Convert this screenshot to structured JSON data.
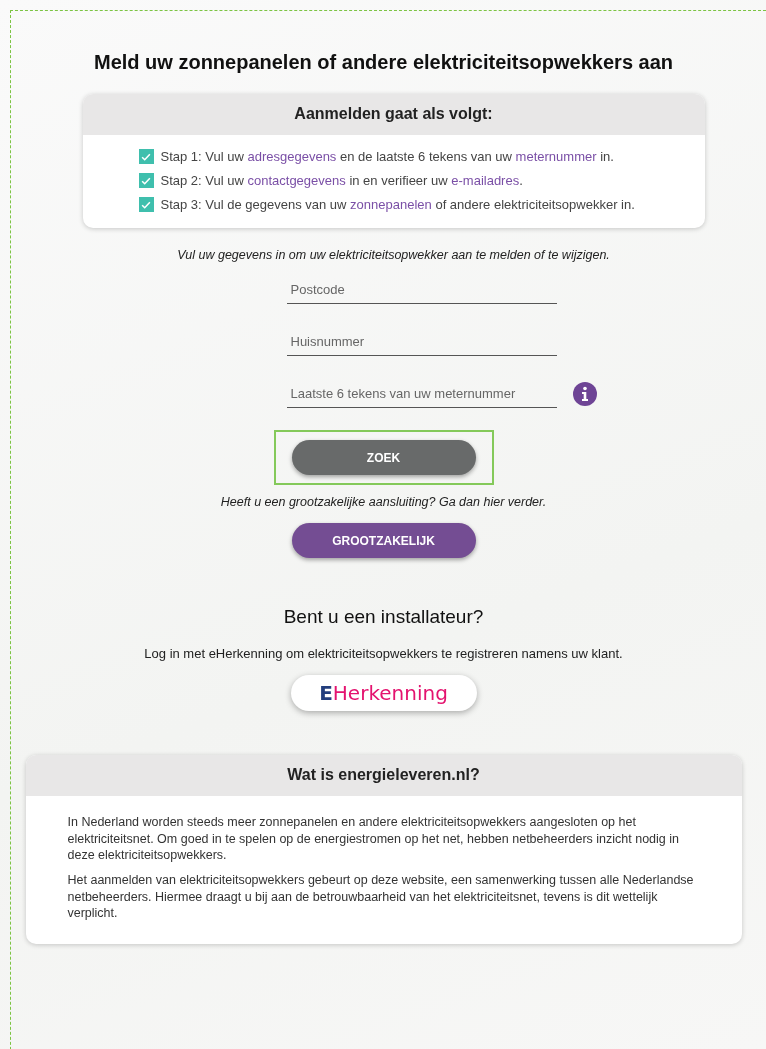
{
  "title": "Meld uw zonnepanelen of andere elektriciteitsopwekkers aan",
  "steps_card": {
    "heading": "Aanmelden gaat als volgt:",
    "steps": [
      {
        "checked": true,
        "parts": [
          {
            "text": "Stap 1: Vul uw ",
            "link": false
          },
          {
            "text": "adresgegevens",
            "link": true
          },
          {
            "text": " en de laatste 6 tekens van uw ",
            "link": false
          },
          {
            "text": "meternummer",
            "link": true
          },
          {
            "text": " in.",
            "link": false
          }
        ]
      },
      {
        "checked": true,
        "parts": [
          {
            "text": "Stap 2: Vul uw ",
            "link": false
          },
          {
            "text": "contactgegevens",
            "link": true
          },
          {
            "text": " in en verifieer uw ",
            "link": false
          },
          {
            "text": "e-mailadres",
            "link": true
          },
          {
            "text": ".",
            "link": false
          }
        ]
      },
      {
        "checked": true,
        "parts": [
          {
            "text": "Stap 3: Vul de gegevens van uw ",
            "link": false
          },
          {
            "text": "zonnepanelen",
            "link": true
          },
          {
            "text": " of andere elektriciteitsopwekker in.",
            "link": false
          }
        ]
      }
    ]
  },
  "intro": "Vul uw gegevens in om uw elektriciteitsopwekker aan te melden of te wijzigen.",
  "fields": [
    {
      "placeholder": "Postcode",
      "info": false
    },
    {
      "placeholder": "Huisnummer",
      "info": false
    },
    {
      "placeholder": "Laatste 6 tekens van uw meternummer",
      "info": true
    }
  ],
  "search_button": {
    "label": "ZOEK",
    "focused": true
  },
  "business_text": "Heeft u een grootzakelijke aansluiting? Ga dan hier verder.",
  "business_button": "GROOTZAKELIJK",
  "installer": {
    "heading": "Bent u een installateur?",
    "text": "Log in met eHerkenning om elektriciteitsopwekkers te registreren namens uw klant.",
    "logo_prefix": "E",
    "logo_rest": "Herkenning"
  },
  "about_card": {
    "heading": "Wat is energieleveren.nl?",
    "paragraphs": [
      "In Nederland worden steeds meer zonnepanelen en andere elektriciteitsopwekkers aangesloten op het elektriciteitsnet. Om goed in te spelen op de energiestromen op het net, hebben netbeheerders inzicht nodig in deze elektriciteitsopwekkers.",
      "Het aanmelden van elektriciteitsopwekkers gebeurt op deze website, een samenwerking tussen alle Nederlandse netbeheerders. Hiermee draagt u bij aan de betrouwbaarheid van het elektriciteitsnet, tevens is dit wettelijk verplicht."
    ]
  }
}
